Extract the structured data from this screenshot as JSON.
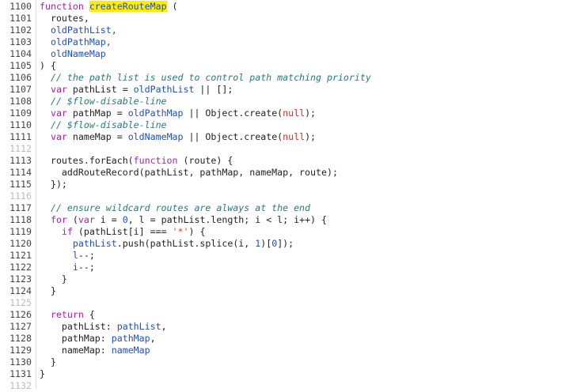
{
  "lines": [
    {
      "n": "1100",
      "tokens": [
        {
          "t": "function ",
          "c": "kw"
        },
        {
          "t": "createRouteMap",
          "c": "hl"
        },
        {
          "t": " (",
          "c": ""
        }
      ]
    },
    {
      "n": "1101",
      "tokens": [
        {
          "t": "  routes,",
          "c": ""
        }
      ]
    },
    {
      "n": "1102",
      "tokens": [
        {
          "t": "  oldPathList,",
          "c": "pl"
        }
      ]
    },
    {
      "n": "1103",
      "tokens": [
        {
          "t": "  oldPathMap,",
          "c": "pl"
        }
      ]
    },
    {
      "n": "1104",
      "tokens": [
        {
          "t": "  oldNameMap",
          "c": "pl"
        }
      ]
    },
    {
      "n": "1105",
      "tokens": [
        {
          "t": ") {",
          "c": ""
        }
      ]
    },
    {
      "n": "1106",
      "tokens": [
        {
          "t": "  // the path list is used to control path matching priority",
          "c": "cm"
        }
      ]
    },
    {
      "n": "1107",
      "tokens": [
        {
          "t": "  ",
          "c": ""
        },
        {
          "t": "var ",
          "c": "kw"
        },
        {
          "t": "pathList = ",
          "c": ""
        },
        {
          "t": "oldPathList",
          "c": "pl"
        },
        {
          "t": " || [];",
          "c": ""
        }
      ]
    },
    {
      "n": "1108",
      "tokens": [
        {
          "t": "  // $flow-disable-line",
          "c": "cm"
        }
      ]
    },
    {
      "n": "1109",
      "tokens": [
        {
          "t": "  ",
          "c": ""
        },
        {
          "t": "var ",
          "c": "kw"
        },
        {
          "t": "pathMap = ",
          "c": ""
        },
        {
          "t": "oldPathMap",
          "c": "pl"
        },
        {
          "t": " || Object.create(",
          "c": ""
        },
        {
          "t": "null",
          "c": "st"
        },
        {
          "t": ");",
          "c": ""
        }
      ]
    },
    {
      "n": "1110",
      "tokens": [
        {
          "t": "  // $flow-disable-line",
          "c": "cm"
        }
      ]
    },
    {
      "n": "1111",
      "tokens": [
        {
          "t": "  ",
          "c": ""
        },
        {
          "t": "var ",
          "c": "kw"
        },
        {
          "t": "nameMap = ",
          "c": ""
        },
        {
          "t": "oldNameMap",
          "c": "pl"
        },
        {
          "t": " || Object.create(",
          "c": ""
        },
        {
          "t": "null",
          "c": "st"
        },
        {
          "t": ");",
          "c": ""
        }
      ]
    },
    {
      "n": "1112",
      "dim": true,
      "tokens": []
    },
    {
      "n": "1113",
      "tokens": [
        {
          "t": "  routes.forEach(",
          "c": ""
        },
        {
          "t": "function ",
          "c": "kw"
        },
        {
          "t": "(route) {",
          "c": ""
        }
      ]
    },
    {
      "n": "1114",
      "tokens": [
        {
          "t": "    addRouteRecord(pathList, pathMap, nameMap, route);",
          "c": ""
        }
      ]
    },
    {
      "n": "1115",
      "tokens": [
        {
          "t": "  });",
          "c": ""
        }
      ]
    },
    {
      "n": "1116",
      "dim": true,
      "tokens": []
    },
    {
      "n": "1117",
      "tokens": [
        {
          "t": "  // ensure wildcard routes are always at the end",
          "c": "cm"
        }
      ]
    },
    {
      "n": "1118",
      "tokens": [
        {
          "t": "  ",
          "c": ""
        },
        {
          "t": "for ",
          "c": "kw"
        },
        {
          "t": "(",
          "c": ""
        },
        {
          "t": "var ",
          "c": "kw"
        },
        {
          "t": "i = ",
          "c": ""
        },
        {
          "t": "0",
          "c": "nu"
        },
        {
          "t": ", l = pathList.length; i < l; i++) {",
          "c": ""
        }
      ]
    },
    {
      "n": "1119",
      "tokens": [
        {
          "t": "    ",
          "c": ""
        },
        {
          "t": "if ",
          "c": "kw"
        },
        {
          "t": "(pathList[i] === ",
          "c": ""
        },
        {
          "t": "'*'",
          "c": "st"
        },
        {
          "t": ") {",
          "c": ""
        }
      ]
    },
    {
      "n": "1120",
      "tokens": [
        {
          "t": "      ",
          "c": ""
        },
        {
          "t": "pathList",
          "c": "bl"
        },
        {
          "t": ".push(pathList.splice(i, ",
          "c": ""
        },
        {
          "t": "1",
          "c": "nu"
        },
        {
          "t": ")[",
          "c": ""
        },
        {
          "t": "0",
          "c": "nu"
        },
        {
          "t": "]);",
          "c": ""
        }
      ]
    },
    {
      "n": "1121",
      "tokens": [
        {
          "t": "      ",
          "c": ""
        },
        {
          "t": "l",
          "c": "bl"
        },
        {
          "t": "--;",
          "c": ""
        }
      ]
    },
    {
      "n": "1122",
      "tokens": [
        {
          "t": "      ",
          "c": ""
        },
        {
          "t": "i",
          "c": "bl"
        },
        {
          "t": "--;",
          "c": ""
        }
      ]
    },
    {
      "n": "1123",
      "tokens": [
        {
          "t": "    }",
          "c": ""
        }
      ]
    },
    {
      "n": "1124",
      "tokens": [
        {
          "t": "  }",
          "c": ""
        }
      ]
    },
    {
      "n": "1125",
      "dim": true,
      "tokens": []
    },
    {
      "n": "1126",
      "tokens": [
        {
          "t": "  ",
          "c": ""
        },
        {
          "t": "return ",
          "c": "kw"
        },
        {
          "t": "{",
          "c": ""
        }
      ]
    },
    {
      "n": "1127",
      "tokens": [
        {
          "t": "    pathList: ",
          "c": ""
        },
        {
          "t": "pathList",
          "c": "bl"
        },
        {
          "t": ",",
          "c": ""
        }
      ]
    },
    {
      "n": "1128",
      "tokens": [
        {
          "t": "    pathMap: ",
          "c": ""
        },
        {
          "t": "pathMap",
          "c": "bl"
        },
        {
          "t": ",",
          "c": ""
        }
      ]
    },
    {
      "n": "1129",
      "tokens": [
        {
          "t": "    nameMap: ",
          "c": ""
        },
        {
          "t": "nameMap",
          "c": "bl"
        }
      ]
    },
    {
      "n": "1130",
      "tokens": [
        {
          "t": "  }",
          "c": ""
        }
      ]
    },
    {
      "n": "1131",
      "tokens": [
        {
          "t": "}",
          "c": ""
        }
      ]
    },
    {
      "n": "1132",
      "dim": true,
      "tokens": []
    }
  ]
}
